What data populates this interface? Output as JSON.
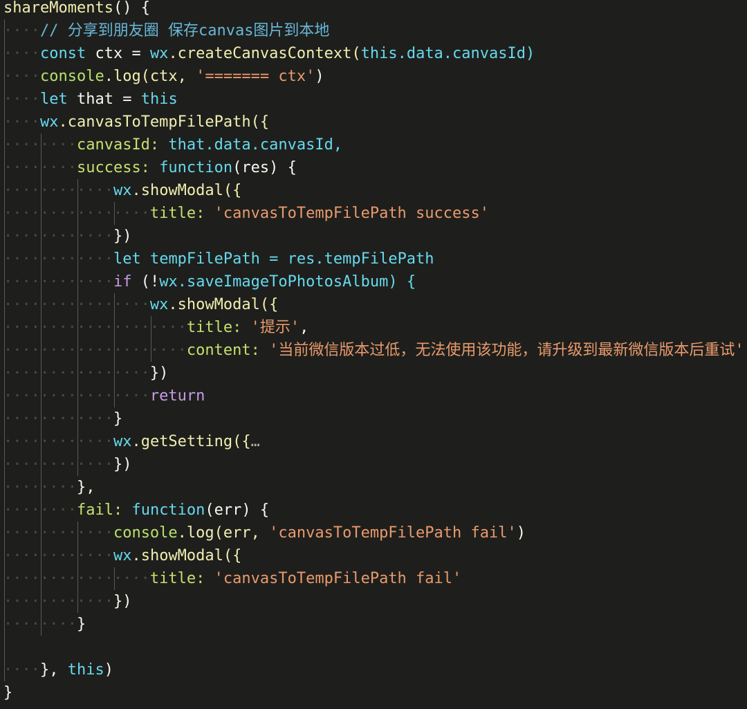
{
  "editor": {
    "theme": {
      "background": "#1e1f1c",
      "keyword": "#66d9ef",
      "string": "#e99a6e",
      "comment": "#68b6d8",
      "property": "#c6e06f",
      "control": "#c79ae8",
      "method": "#f1efb0"
    },
    "lines": [
      [
        {
          "t": "shareMoments",
          "c": "tok-method"
        },
        {
          "t": "() {",
          "c": "tok-plain"
        }
      ],
      [
        {
          "t": "    ",
          "c": "ws",
          "ind": 1
        },
        {
          "t": "// 分享到朋友圈 保存canvas图片到本地",
          "c": "tok-comment"
        }
      ],
      [
        {
          "t": "    ",
          "c": "ws",
          "ind": 1
        },
        {
          "t": "const",
          "c": "tok-kw"
        },
        {
          "t": " ctx = ",
          "c": "tok-plain"
        },
        {
          "t": "wx",
          "c": "tok-obj"
        },
        {
          "t": ".createCanvasContext(",
          "c": "tok-method"
        },
        {
          "t": "this",
          "c": "tok-this"
        },
        {
          "t": ".data.canvasId)",
          "c": "tok-obj"
        }
      ],
      [
        {
          "t": "    ",
          "c": "ws",
          "ind": 1
        },
        {
          "t": "console",
          "c": "tok-log"
        },
        {
          "t": ".log(ctx, ",
          "c": "tok-method"
        },
        {
          "t": "'======= ctx'",
          "c": "tok-str"
        },
        {
          "t": ")",
          "c": "tok-plain"
        }
      ],
      [
        {
          "t": "    ",
          "c": "ws",
          "ind": 1
        },
        {
          "t": "let",
          "c": "tok-kw"
        },
        {
          "t": " that = ",
          "c": "tok-plain"
        },
        {
          "t": "this",
          "c": "tok-this"
        }
      ],
      [
        {
          "t": "    ",
          "c": "ws",
          "ind": 1
        },
        {
          "t": "wx",
          "c": "tok-obj"
        },
        {
          "t": ".canvasToTempFilePath({",
          "c": "tok-method"
        }
      ],
      [
        {
          "t": "        ",
          "c": "ws",
          "ind": 2
        },
        {
          "t": "canvasId:",
          "c": "tok-key"
        },
        {
          "t": " that.data.canvasId,",
          "c": "tok-obj"
        }
      ],
      [
        {
          "t": "        ",
          "c": "ws",
          "ind": 2
        },
        {
          "t": "success:",
          "c": "tok-key"
        },
        {
          "t": " ",
          "c": "tok-plain"
        },
        {
          "t": "function",
          "c": "tok-kw"
        },
        {
          "t": "(res) {",
          "c": "tok-plain"
        }
      ],
      [
        {
          "t": "            ",
          "c": "ws",
          "ind": 3
        },
        {
          "t": "wx",
          "c": "tok-obj"
        },
        {
          "t": ".showModal({",
          "c": "tok-method"
        }
      ],
      [
        {
          "t": "                ",
          "c": "ws",
          "ind": 4
        },
        {
          "t": "title:",
          "c": "tok-key"
        },
        {
          "t": " ",
          "c": "tok-plain"
        },
        {
          "t": "'canvasToTempFilePath success'",
          "c": "tok-str"
        }
      ],
      [
        {
          "t": "            ",
          "c": "ws",
          "ind": 3
        },
        {
          "t": "})",
          "c": "tok-plain"
        }
      ],
      [
        {
          "t": "            ",
          "c": "ws",
          "ind": 3
        },
        {
          "t": "let",
          "c": "tok-kw"
        },
        {
          "t": " tempFilePath = res.tempFilePath",
          "c": "tok-obj"
        }
      ],
      [
        {
          "t": "            ",
          "c": "ws",
          "ind": 3
        },
        {
          "t": "if",
          "c": "tok-kw2"
        },
        {
          "t": " (!",
          "c": "tok-plain"
        },
        {
          "t": "wx",
          "c": "tok-obj"
        },
        {
          "t": ".saveImageToPhotosAlbum) {",
          "c": "tok-obj"
        }
      ],
      [
        {
          "t": "                ",
          "c": "ws",
          "ind": 4
        },
        {
          "t": "wx",
          "c": "tok-obj"
        },
        {
          "t": ".showModal({",
          "c": "tok-method"
        }
      ],
      [
        {
          "t": "                    ",
          "c": "ws",
          "ind": 5
        },
        {
          "t": "title:",
          "c": "tok-key"
        },
        {
          "t": " ",
          "c": "tok-plain"
        },
        {
          "t": "'提示'",
          "c": "tok-str"
        },
        {
          "t": ",",
          "c": "tok-plain"
        }
      ],
      [
        {
          "t": "                    ",
          "c": "ws",
          "ind": 5
        },
        {
          "t": "content:",
          "c": "tok-key"
        },
        {
          "t": " ",
          "c": "tok-plain"
        },
        {
          "t": "'当前微信版本过低，无法使用该功能，请升级到最新微信版本后重试'",
          "c": "tok-str"
        }
      ],
      [
        {
          "t": "                ",
          "c": "ws",
          "ind": 4
        },
        {
          "t": "})",
          "c": "tok-plain"
        }
      ],
      [
        {
          "t": "                ",
          "c": "ws",
          "ind": 4
        },
        {
          "t": "return",
          "c": "tok-kw2"
        }
      ],
      [
        {
          "t": "            ",
          "c": "ws",
          "ind": 3
        },
        {
          "t": "}",
          "c": "tok-plain"
        }
      ],
      [
        {
          "t": "            ",
          "c": "ws",
          "ind": 3
        },
        {
          "t": "wx",
          "c": "tok-obj"
        },
        {
          "t": ".getSetting({",
          "c": "tok-method"
        },
        {
          "t": "…",
          "c": "tok-ellipsis"
        }
      ],
      [
        {
          "t": "            ",
          "c": "ws",
          "ind": 3
        },
        {
          "t": "})",
          "c": "tok-plain"
        }
      ],
      [
        {
          "t": "        ",
          "c": "ws",
          "ind": 2
        },
        {
          "t": "},",
          "c": "tok-plain"
        }
      ],
      [
        {
          "t": "        ",
          "c": "ws",
          "ind": 2
        },
        {
          "t": "fail:",
          "c": "tok-key"
        },
        {
          "t": " ",
          "c": "tok-plain"
        },
        {
          "t": "function",
          "c": "tok-kw"
        },
        {
          "t": "(err) {",
          "c": "tok-plain"
        }
      ],
      [
        {
          "t": "            ",
          "c": "ws",
          "ind": 3
        },
        {
          "t": "console",
          "c": "tok-log"
        },
        {
          "t": ".log(err, ",
          "c": "tok-method"
        },
        {
          "t": "'canvasToTempFilePath fail'",
          "c": "tok-str"
        },
        {
          "t": ")",
          "c": "tok-plain"
        }
      ],
      [
        {
          "t": "            ",
          "c": "ws",
          "ind": 3
        },
        {
          "t": "wx",
          "c": "tok-obj"
        },
        {
          "t": ".showModal({",
          "c": "tok-method"
        }
      ],
      [
        {
          "t": "                ",
          "c": "ws",
          "ind": 4
        },
        {
          "t": "title:",
          "c": "tok-key"
        },
        {
          "t": " ",
          "c": "tok-plain"
        },
        {
          "t": "'canvasToTempFilePath fail'",
          "c": "tok-str"
        }
      ],
      [
        {
          "t": "            ",
          "c": "ws",
          "ind": 3
        },
        {
          "t": "})",
          "c": "tok-plain"
        }
      ],
      [
        {
          "t": "        ",
          "c": "ws",
          "ind": 2
        },
        {
          "t": "}",
          "c": "tok-plain"
        }
      ],
      [
        {
          "t": "",
          "c": "ws",
          "ind": 1
        }
      ],
      [
        {
          "t": "    ",
          "c": "ws",
          "ind": 1
        },
        {
          "t": "}, ",
          "c": "tok-plain"
        },
        {
          "t": "this",
          "c": "tok-this"
        },
        {
          "t": ")",
          "c": "tok-plain"
        }
      ],
      [
        {
          "t": "}",
          "c": "tok-plain"
        }
      ]
    ]
  }
}
